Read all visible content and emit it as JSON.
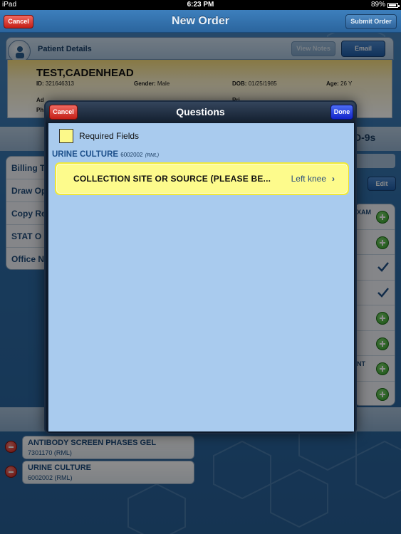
{
  "status_bar": {
    "device": "iPad",
    "time": "6:23 PM",
    "battery": "89%"
  },
  "nav": {
    "cancel_label": "Cancel",
    "title": "New Order",
    "submit_label": "Submit Order"
  },
  "patient": {
    "header_title": "Patient Details",
    "view_notes_label": "View Notes",
    "email_label": "Email",
    "name": "TEST,CADENHEAD",
    "id_label": "ID:",
    "id_value": "321646313",
    "gender_label": "Gender:",
    "gender_value": "Male",
    "dob_label": "DOB:",
    "dob_value": "01/25/1985",
    "age_label": "Age:",
    "age_value": "26 Y",
    "addr_label": "Ad",
    "phone_label": "Ph",
    "other_label": "Pri"
  },
  "left_menu": {
    "items": [
      {
        "label": "Billing T"
      },
      {
        "label": "Draw Op"
      },
      {
        "label": "Copy Re"
      },
      {
        "label": "STAT O"
      },
      {
        "label": "Office N"
      }
    ]
  },
  "right_panel": {
    "icd_label": "D-9s",
    "edit_label": "Edit",
    "items": [
      {
        "label": "XAM",
        "icon": "plus-icon"
      },
      {
        "label": "",
        "icon": "plus-icon"
      },
      {
        "label": "",
        "icon": "check-icon"
      },
      {
        "label": "",
        "icon": "check-icon"
      },
      {
        "label": "",
        "icon": "plus-icon"
      },
      {
        "label": "",
        "icon": "plus-icon"
      },
      {
        "label": "NT",
        "icon": "plus-icon"
      },
      {
        "label": "",
        "icon": "plus-icon"
      }
    ]
  },
  "ordered_tests": [
    {
      "name": "ANTIBODY SCREEN PHASES GEL",
      "code": "7301170 (RML)"
    },
    {
      "name": "URINE CULTURE",
      "code": "6002002 (RML)"
    }
  ],
  "modal": {
    "title": "Questions",
    "cancel_label": "Cancel",
    "done_label": "Done",
    "required_fields_label": "Required Fields",
    "section": {
      "name": "URINE CULTURE",
      "code": "6002002",
      "lab": "(RML)"
    },
    "question": {
      "label": "COLLECTION SITE OR SOURCE (PLEASE BE...",
      "value": "Left knee"
    }
  },
  "colors": {
    "accent_blue": "#2f6ea9",
    "required_yellow": "#fdfb8c",
    "cancel_red": "#c41f17",
    "done_blue": "#1224c9",
    "modal_body": "#a9cbee"
  }
}
